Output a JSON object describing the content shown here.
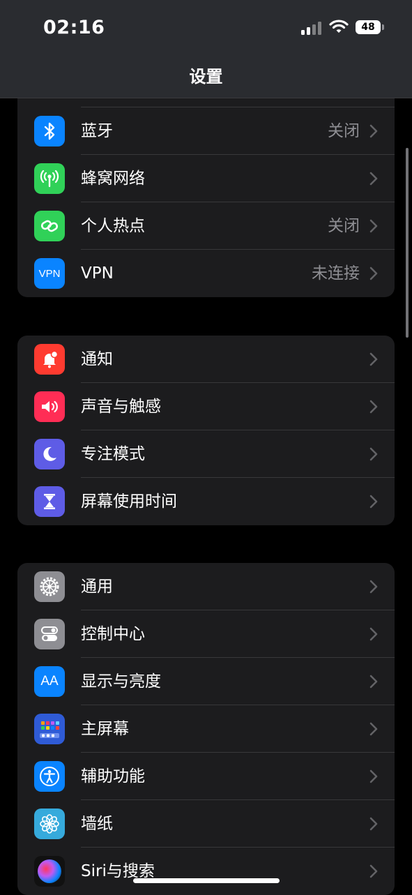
{
  "status": {
    "time": "02:16",
    "battery": "48"
  },
  "nav": {
    "title": "设置"
  },
  "group1": [
    {
      "label": "蓝牙",
      "value": "关闭",
      "icon": "bluetooth-icon",
      "color": "#0a84ff"
    },
    {
      "label": "蜂窝网络",
      "value": "",
      "icon": "cellular-icon",
      "color": "#30d158"
    },
    {
      "label": "个人热点",
      "value": "关闭",
      "icon": "hotspot-icon",
      "color": "#30d158"
    },
    {
      "label": "VPN",
      "value": "未连接",
      "icon": "vpn-icon",
      "color": "#0a84ff",
      "icon_text": "VPN"
    }
  ],
  "group2": [
    {
      "label": "通知",
      "icon": "notification-bell-icon",
      "color": "#ff3b30"
    },
    {
      "label": "声音与触感",
      "icon": "speaker-icon",
      "color": "#ff2d55"
    },
    {
      "label": "专注模式",
      "icon": "moon-icon",
      "color": "#5e5ce6"
    },
    {
      "label": "屏幕使用时间",
      "icon": "hourglass-icon",
      "color": "#5e5ce6"
    }
  ],
  "group3": [
    {
      "label": "通用",
      "icon": "gear-icon",
      "color": "#8e8e93"
    },
    {
      "label": "控制中心",
      "icon": "toggles-icon",
      "color": "#8e8e93"
    },
    {
      "label": "显示与亮度",
      "icon": "text-size-icon",
      "color": "#0a84ff",
      "icon_text": "AA"
    },
    {
      "label": "主屏幕",
      "icon": "home-screen-grid-icon",
      "color": "#2f5bd6"
    },
    {
      "label": "辅助功能",
      "icon": "accessibility-icon",
      "color": "#0a84ff"
    },
    {
      "label": "墙纸",
      "icon": "wallpaper-flower-icon",
      "color": "#36aadc"
    },
    {
      "label": "Siri与搜索",
      "icon": "siri-icon",
      "color": "#111111"
    }
  ]
}
